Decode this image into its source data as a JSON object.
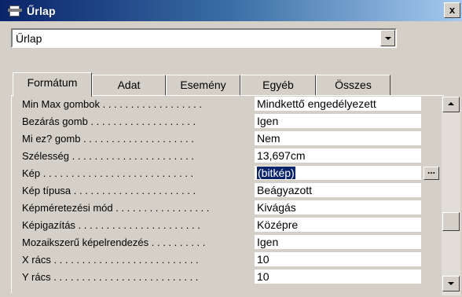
{
  "window": {
    "title": "Űrlap",
    "close_label": "x"
  },
  "object_selector": {
    "value": "Űrlap"
  },
  "tabs": [
    {
      "label": "Formátum",
      "active": true
    },
    {
      "label": "Adat",
      "active": false
    },
    {
      "label": "Esemény",
      "active": false
    },
    {
      "label": "Egyéb",
      "active": false
    },
    {
      "label": "Összes",
      "active": false
    }
  ],
  "properties": [
    {
      "label": "Min Max gombok . . . . . . . . . . . . . . . . . .",
      "value": "Mindkettő engedélyezett"
    },
    {
      "label": "Bezárás gomb . . . . . . . . . . . . . . . . . . .",
      "value": "Igen"
    },
    {
      "label": "Mi ez? gomb . . . . . . . . . . . . . . . . . . . .",
      "value": "Nem"
    },
    {
      "label": "Szélesség . . . . . . . . . . . . . . . . . . . . . .",
      "value": "13,697cm"
    },
    {
      "label": "Kép . . . . . . . . . . . . . . . . . . . . . . . . . . .",
      "value": "(bitkép)",
      "selected": true
    },
    {
      "label": "Kép típusa . . . . . . . . . . . . . . . . . . . . . .",
      "value": "Beágyazott"
    },
    {
      "label": "Képméretezési mód . . . . . . . . . . . . . . . . .",
      "value": "Kivágás"
    },
    {
      "label": "Képigazítás . . . . . . . . . . . . . . . . . . . . . .",
      "value": "Középre"
    },
    {
      "label": "Mozaikszerű képelrendezés . . . . . . . . . .",
      "value": "Igen"
    },
    {
      "label": "X rács . . . . . . . . . . . . . . . . . . . . . . . . . .",
      "value": "10"
    },
    {
      "label": "Y rács . . . . . . . . . . . . . . . . . . . . . . . . . .",
      "value": "10"
    }
  ],
  "builder_button": {
    "label": "..."
  }
}
